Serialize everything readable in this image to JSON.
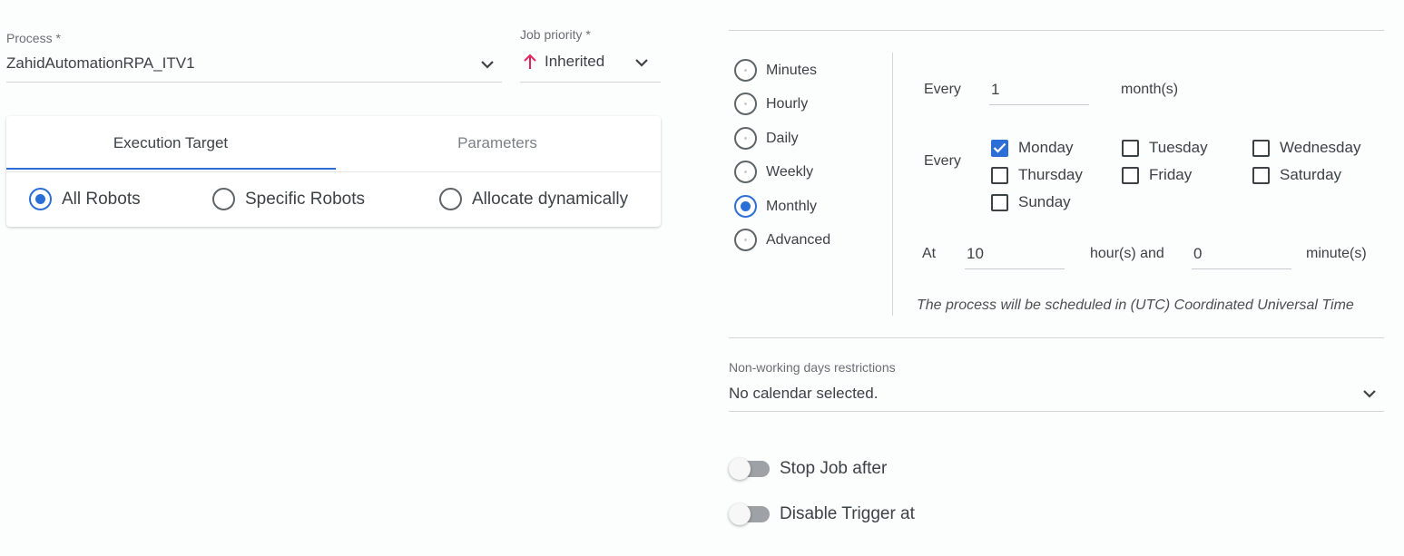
{
  "process": {
    "label": "Process *",
    "value": "ZahidAutomationRPA_ITV1",
    "icon": "chevron-down-icon"
  },
  "job_priority": {
    "label": "Job priority *",
    "value": "Inherited",
    "icon": "arrow-up-icon",
    "icon_color": "#e0245e"
  },
  "execution_tabs": [
    {
      "label": "Execution Target",
      "active": true
    },
    {
      "label": "Parameters",
      "active": false
    }
  ],
  "robot_options": [
    {
      "label": "All Robots",
      "selected": true
    },
    {
      "label": "Specific Robots",
      "selected": false
    },
    {
      "label": "Allocate dynamically",
      "selected": false
    }
  ],
  "frequency_options": [
    {
      "label": "Minutes",
      "selected": false
    },
    {
      "label": "Hourly",
      "selected": false
    },
    {
      "label": "Daily",
      "selected": false
    },
    {
      "label": "Weekly",
      "selected": false
    },
    {
      "label": "Monthly",
      "selected": true
    },
    {
      "label": "Advanced",
      "selected": false
    }
  ],
  "schedule": {
    "every_label": "Every",
    "interval_value": "1",
    "interval_unit": "month(s)",
    "days_label": "Every",
    "days": [
      {
        "label": "Monday",
        "checked": true
      },
      {
        "label": "Tuesday",
        "checked": false
      },
      {
        "label": "Wednesday",
        "checked": false
      },
      {
        "label": "Thursday",
        "checked": false
      },
      {
        "label": "Friday",
        "checked": false
      },
      {
        "label": "Saturday",
        "checked": false
      },
      {
        "label": "Sunday",
        "checked": false
      }
    ],
    "at_label": "At",
    "hour_value": "10",
    "hour_unit": "hour(s) and",
    "minute_value": "0",
    "minute_unit": "minute(s)",
    "timezone_note": "The process will be scheduled in (UTC) Coordinated Universal Time"
  },
  "non_working_days": {
    "label": "Non-working days restrictions",
    "value": "No calendar selected.",
    "icon": "chevron-down-icon"
  },
  "toggles": [
    {
      "label": "Stop Job after",
      "on": false
    },
    {
      "label": "Disable Trigger at",
      "on": false
    }
  ],
  "colors": {
    "accent": "#2b6fd6",
    "priority_arrow": "#e0245e",
    "text": "#3d4246"
  }
}
